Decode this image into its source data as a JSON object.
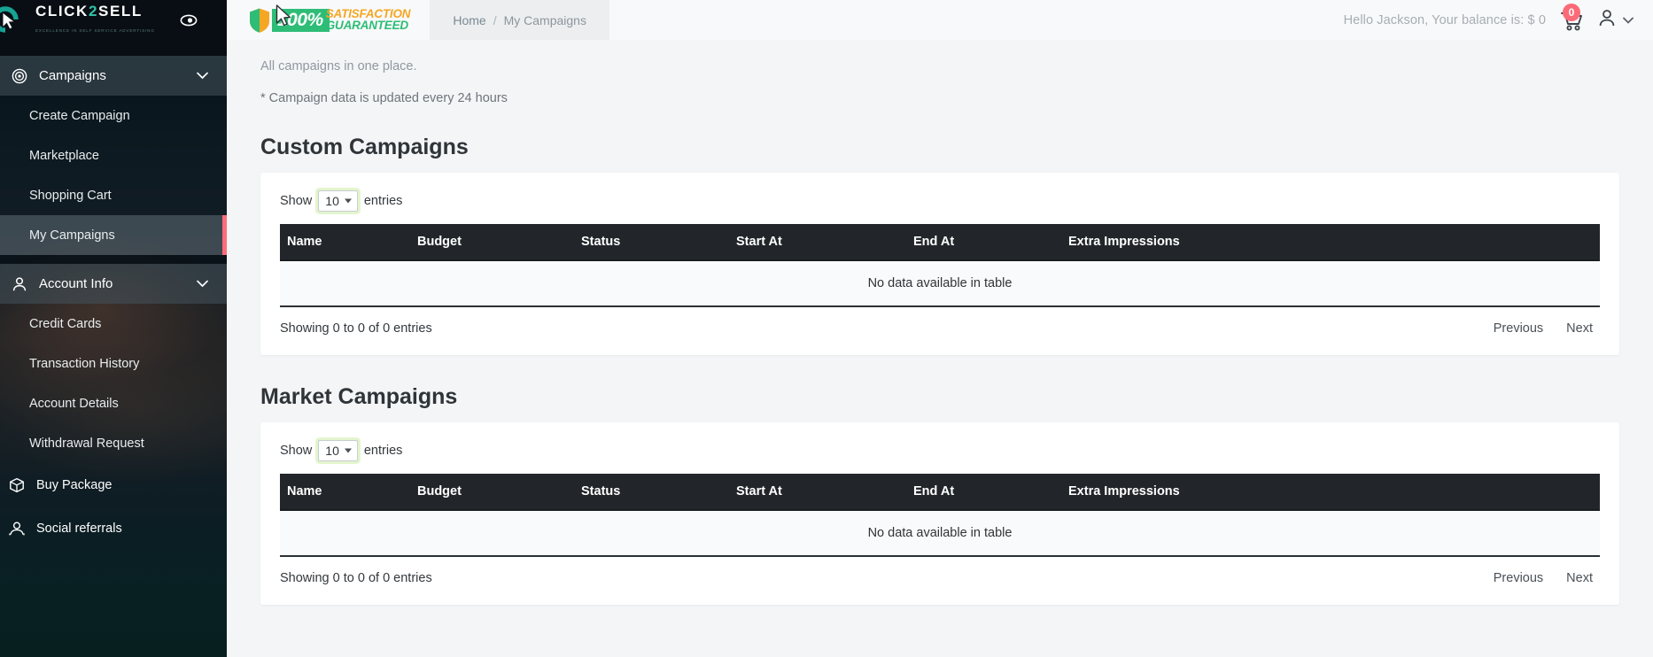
{
  "brand": {
    "name_part1": "CLICK",
    "name_two": "2",
    "name_part2": "SELL",
    "tagline": "EXCELLENCE IN SELF SERVICE ADVERTISING",
    "toggle_icon": "eye-icon",
    "accent_teal": "#2fc4a8",
    "active_marker": "#ff6b7a"
  },
  "sidebar": {
    "groups": [
      {
        "label": "Campaigns",
        "icon": "target-icon",
        "chevron": "chevron-down-icon",
        "expanded": true,
        "items": [
          {
            "label": "Create Campaign",
            "active": false
          },
          {
            "label": "Marketplace",
            "active": false
          },
          {
            "label": "Shopping Cart",
            "active": false
          },
          {
            "label": "My Campaigns",
            "active": true
          }
        ]
      },
      {
        "label": "Account Info",
        "icon": "user-icon",
        "chevron": "chevron-down-icon",
        "expanded": true,
        "items": [
          {
            "label": "Credit Cards",
            "active": false
          },
          {
            "label": "Transaction History",
            "active": false
          },
          {
            "label": "Account Details",
            "active": false
          },
          {
            "label": "Withdrawal Request",
            "active": false
          }
        ]
      }
    ],
    "links": [
      {
        "label": "Buy Package",
        "icon": "package-icon"
      },
      {
        "label": "Social referrals",
        "icon": "people-icon"
      }
    ]
  },
  "topbar": {
    "guarantee": {
      "percent": "100%",
      "line1": "SATISFACTION",
      "line2": "GUARANTEED",
      "shield_icon": "shield-icon",
      "green": "#2ebd77",
      "orange": "#f5a623"
    },
    "breadcrumb": {
      "home": "Home",
      "separator": "/",
      "current": "My Campaigns"
    },
    "greeting": "Hello Jackson, Your balance is: $ 0",
    "cart": {
      "icon": "cart-icon",
      "badge": "0",
      "badge_color": "#fb6a78"
    },
    "account": {
      "icon": "user-avatar-icon",
      "chevron": "chevron-down-icon"
    }
  },
  "main": {
    "lead": "All campaigns in one place.",
    "note": "* Campaign data is updated every 24 hours",
    "sections": [
      {
        "title": "Custom Campaigns",
        "show_label": "Show",
        "entries_label": "entries",
        "page_length": "10",
        "columns": [
          "Name",
          "Budget",
          "Status",
          "Start At",
          "End At",
          "Extra Impressions"
        ],
        "empty_message": "No data available in table",
        "info": "Showing 0 to 0 of 0 entries",
        "previous": "Previous",
        "next": "Next"
      },
      {
        "title": "Market Campaigns",
        "show_label": "Show",
        "entries_label": "entries",
        "page_length": "10",
        "columns": [
          "Name",
          "Budget",
          "Status",
          "Start At",
          "End At",
          "Extra Impressions"
        ],
        "empty_message": "No data available in table",
        "info": "Showing 0 to 0 of 0 entries",
        "previous": "Previous",
        "next": "Next"
      }
    ]
  }
}
